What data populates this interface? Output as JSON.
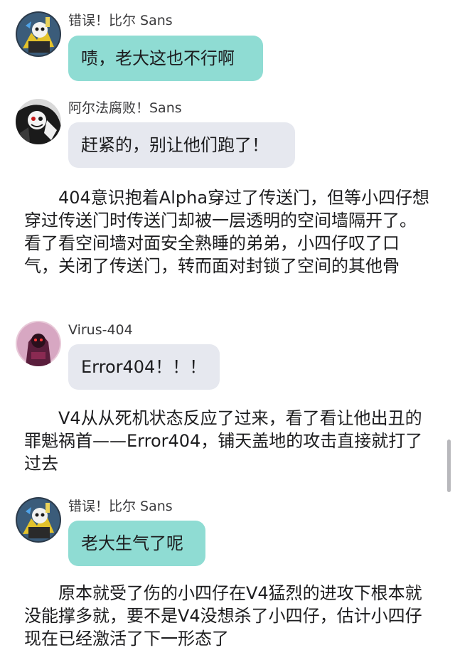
{
  "messages": [
    {
      "sender": "错误！比尔 Sans",
      "text": "啧，老大这也不行啊",
      "avatar_icon": "error-bill-sans-avatar",
      "bubble_color": "#8fdcd3"
    },
    {
      "sender": "阿尔法腐败！Sans",
      "text": "赶紧的，别让他们跑了！",
      "avatar_icon": "alpha-corrupt-sans-avatar",
      "bubble_color": "#e6e8ef"
    },
    {
      "sender": "Virus-404",
      "text": "Error404！！！",
      "avatar_icon": "virus-404-avatar",
      "bubble_color": "#e6e8ef"
    },
    {
      "sender": "错误！比尔 Sans",
      "text": "老大生气了呢",
      "avatar_icon": "error-bill-sans-avatar",
      "bubble_color": "#8fdcd3"
    }
  ],
  "narrations": [
    "404意识抱着Alpha穿过了传送门，但等小四仔想穿过传送门时传送门却被一层透明的空间墙隔开了。看了看空间墙对面安全熟睡的弟弟，小四仔叹了口气，关闭了传送门，转而面对封锁了空间的其他骨",
    "V4从从死机状态反应了过来，看了看让他出丑的罪魁祸首——Error404，铺天盖地的攻击直接就打了过去",
    "原本就受了伤的小四仔在V4猛烈的进攻下根本就没能撑多就，要不是V4没想杀了小四仔，估计小四仔现在已经激活了下一形态了"
  ]
}
